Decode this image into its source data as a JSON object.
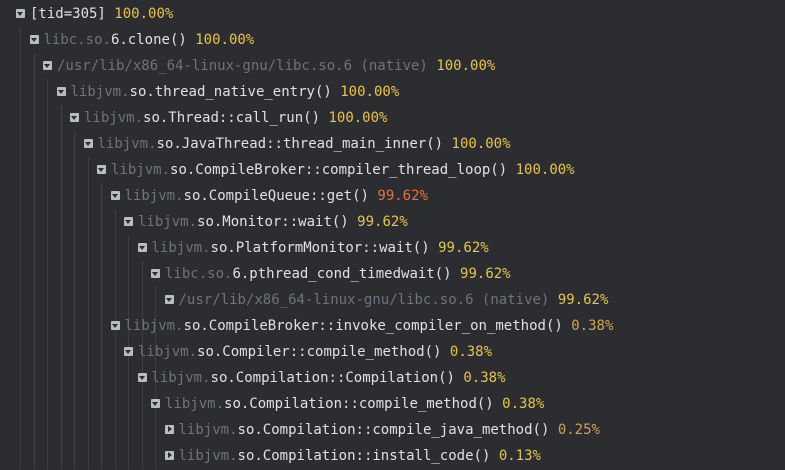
{
  "nodes": [
    {
      "indent": 0,
      "state": "expanded",
      "dim": "",
      "name": "[tid=305]",
      "pct": "100.00%",
      "pct_class": "pct-high"
    },
    {
      "indent": 1,
      "state": "expanded",
      "dim": "libc.so.",
      "name": "6.clone()",
      "pct": "100.00%",
      "pct_class": "pct-high"
    },
    {
      "indent": 2,
      "state": "expanded",
      "dim": "/usr/lib/x86_64-linux-gnu/libc.so.6 (native)",
      "name": "",
      "pct": "100.00%",
      "pct_class": "pct-high"
    },
    {
      "indent": 3,
      "state": "expanded",
      "dim": "libjvm.",
      "name": "so.thread_native_entry()",
      "pct": "100.00%",
      "pct_class": "pct-high"
    },
    {
      "indent": 4,
      "state": "expanded",
      "dim": "libjvm.",
      "name": "so.Thread::call_run()",
      "pct": "100.00%",
      "pct_class": "pct-high"
    },
    {
      "indent": 5,
      "state": "expanded",
      "dim": "libjvm.",
      "name": "so.JavaThread::thread_main_inner()",
      "pct": "100.00%",
      "pct_class": "pct-high"
    },
    {
      "indent": 6,
      "state": "expanded",
      "dim": "libjvm.",
      "name": "so.CompileBroker::compiler_thread_loop()",
      "pct": "100.00%",
      "pct_class": "pct-high"
    },
    {
      "indent": 7,
      "state": "expanded",
      "dim": "libjvm.",
      "name": "so.CompileQueue::get()",
      "pct": "99.62%",
      "pct_class": "pct-red"
    },
    {
      "indent": 8,
      "state": "expanded",
      "dim": "libjvm.",
      "name": "so.Monitor::wait()",
      "pct": "99.62%",
      "pct_class": "pct-high"
    },
    {
      "indent": 9,
      "state": "expanded",
      "dim": "libjvm.",
      "name": "so.PlatformMonitor::wait()",
      "pct": "99.62%",
      "pct_class": "pct-high"
    },
    {
      "indent": 10,
      "state": "expanded",
      "dim": "libc.so.",
      "name": "6.pthread_cond_timedwait()",
      "pct": "99.62%",
      "pct_class": "pct-high"
    },
    {
      "indent": 11,
      "state": "expanded",
      "dim": "/usr/lib/x86_64-linux-gnu/libc.so.6 (native)",
      "name": "",
      "pct": "99.62%",
      "pct_class": "pct-high"
    },
    {
      "indent": 7,
      "state": "expanded",
      "dim": "libjvm.",
      "name": "so.CompileBroker::invoke_compiler_on_method()",
      "pct": "0.38%",
      "pct_class": "pct-low"
    },
    {
      "indent": 8,
      "state": "expanded",
      "dim": "libjvm.",
      "name": "so.Compiler::compile_method()",
      "pct": "0.38%",
      "pct_class": "pct-high"
    },
    {
      "indent": 9,
      "state": "expanded",
      "dim": "libjvm.",
      "name": "so.Compilation::Compilation()",
      "pct": "0.38%",
      "pct_class": "pct-high"
    },
    {
      "indent": 10,
      "state": "expanded",
      "dim": "libjvm.",
      "name": "so.Compilation::compile_method()",
      "pct": "0.38%",
      "pct_class": "pct-high"
    },
    {
      "indent": 11,
      "state": "collapsed",
      "dim": "libjvm.",
      "name": "so.Compilation::compile_java_method()",
      "pct": "0.25%",
      "pct_class": "pct-low"
    },
    {
      "indent": 11,
      "state": "collapsed",
      "dim": "libjvm.",
      "name": "so.Compilation::install_code()",
      "pct": "0.13%",
      "pct_class": "pct-high"
    }
  ]
}
